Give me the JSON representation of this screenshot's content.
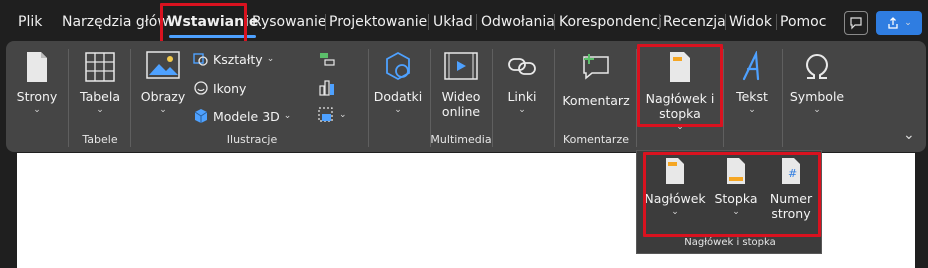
{
  "tabs": [
    {
      "label": "Plik"
    },
    {
      "label": "Narzędzia głów"
    },
    {
      "label": "Wstawianie"
    },
    {
      "label": "Rysowanie"
    },
    {
      "label": "Projektowanie"
    },
    {
      "label": "Układ"
    },
    {
      "label": "Odwołania"
    },
    {
      "label": "Korespondencj"
    },
    {
      "label": "Recenzja"
    },
    {
      "label": "Widok"
    },
    {
      "label": "Pomoc"
    }
  ],
  "ribbon": {
    "pages": {
      "label": "Strony"
    },
    "tables": {
      "label": "Tabela",
      "group": "Tabele"
    },
    "illustrations": {
      "pictures": "Obrazy",
      "shapes": "Kształty",
      "icons": "Ikony",
      "models3d": "Modele 3D",
      "group": "Ilustracje"
    },
    "addins": {
      "label": "Dodatki"
    },
    "multimedia": {
      "line1": "Wideo",
      "line2": "online",
      "group": "Multimedia"
    },
    "links": {
      "label": "Linki"
    },
    "comments": {
      "label": "Komentarz",
      "group": "Komentarze"
    },
    "header_footer": {
      "line1": "Nagłówek i",
      "line2": "stopka"
    },
    "text": {
      "label": "Tekst"
    },
    "symbols": {
      "label": "Symbole"
    }
  },
  "dropdown": {
    "header": "Nagłówek",
    "footer": "Stopka",
    "page_number_line1": "Numer",
    "page_number_line2": "strony",
    "group": "Nagłówek i stopka"
  },
  "colors": {
    "accent": "#4ea1ff",
    "highlight": "#d9121f",
    "share": "#2f7de1"
  }
}
